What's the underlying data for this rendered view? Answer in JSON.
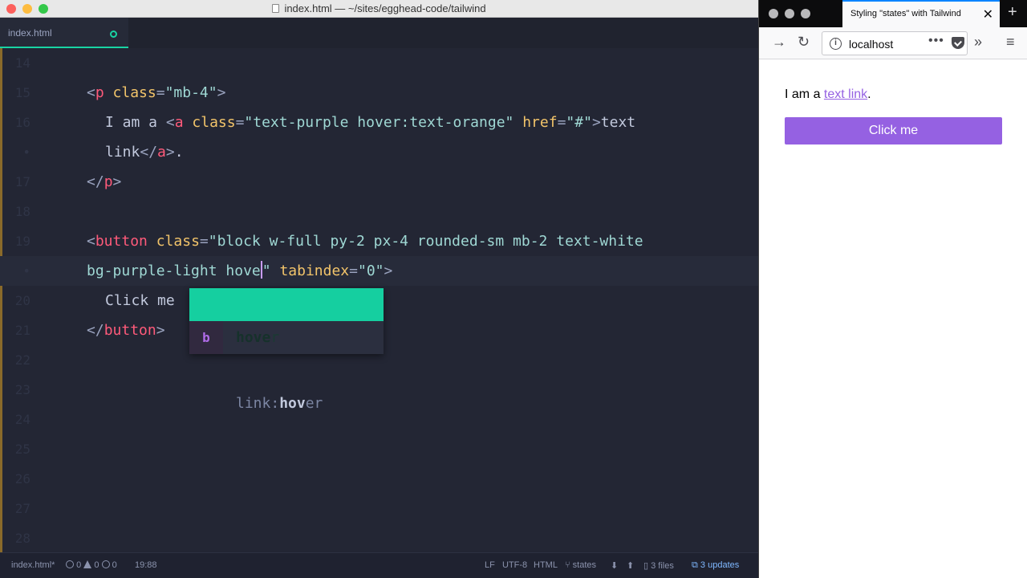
{
  "editor": {
    "window_title": "index.html — ~/sites/egghead-code/tailwind",
    "tab_label": "index.html",
    "lines": [
      {
        "num": "14",
        "parts": []
      },
      {
        "num": "15",
        "parts": [
          [
            "pun",
            "<"
          ],
          [
            "tag",
            "p"
          ],
          [
            "plain",
            " "
          ],
          [
            "attr",
            "class"
          ],
          [
            "pun",
            "="
          ],
          [
            "str",
            "\"mb-4\""
          ],
          [
            "pun",
            ">"
          ]
        ]
      },
      {
        "num": "16",
        "indent": 2,
        "parts": [
          [
            "plain",
            "I am a "
          ],
          [
            "pun",
            "<"
          ],
          [
            "tag",
            "a"
          ],
          [
            "plain",
            " "
          ],
          [
            "attr",
            "class"
          ],
          [
            "pun",
            "="
          ],
          [
            "str",
            "\"text-purple hover:text-orange\""
          ],
          [
            "plain",
            " "
          ],
          [
            "attr",
            "href"
          ],
          [
            "pun",
            "="
          ],
          [
            "str",
            "\"#\""
          ],
          [
            "pun",
            ">"
          ],
          [
            "plain",
            "text"
          ]
        ]
      },
      {
        "num": "•",
        "indent": 2,
        "parts": [
          [
            "plain",
            "link"
          ],
          [
            "pun",
            "</"
          ],
          [
            "tag",
            "a"
          ],
          [
            "pun",
            ">"
          ],
          [
            "plain",
            "."
          ]
        ]
      },
      {
        "num": "17",
        "parts": [
          [
            "pun",
            "</"
          ],
          [
            "tag",
            "p"
          ],
          [
            "pun",
            ">"
          ]
        ]
      },
      {
        "num": "18",
        "parts": []
      },
      {
        "num": "19",
        "parts": [
          [
            "pun",
            "<"
          ],
          [
            "tag",
            "button"
          ],
          [
            "plain",
            " "
          ],
          [
            "attr",
            "class"
          ],
          [
            "pun",
            "="
          ],
          [
            "str",
            "\"block w-full py-2 px-4 rounded-sm mb-2 text-white"
          ]
        ]
      },
      {
        "num": "•",
        "active": true,
        "parts": [
          [
            "str",
            "bg-purple-light hove"
          ],
          [
            "cursor",
            ""
          ],
          [
            "str",
            "\""
          ],
          [
            "plain",
            " "
          ],
          [
            "attr",
            "tabindex"
          ],
          [
            "pun",
            "="
          ],
          [
            "str",
            "\"0\""
          ],
          [
            "pun",
            ">"
          ]
        ]
      },
      {
        "num": "20",
        "indent": 2,
        "parts": [
          [
            "plain",
            "Click me"
          ]
        ]
      },
      {
        "num": "21",
        "parts": [
          [
            "pun",
            "</"
          ],
          [
            "tag",
            "button"
          ],
          [
            "pun",
            ">"
          ]
        ]
      },
      {
        "num": "22",
        "parts": []
      },
      {
        "num": "23",
        "parts": []
      },
      {
        "num": "24",
        "parts": []
      },
      {
        "num": "25",
        "parts": []
      },
      {
        "num": "26",
        "parts": []
      },
      {
        "num": "27",
        "parts": []
      },
      {
        "num": "28",
        "parts": []
      }
    ],
    "autocomplete": {
      "selected": {
        "match": "hove",
        "rest": "r"
      },
      "second": {
        "type_badge": "b",
        "prefix": "link:",
        "match": "hov",
        "rest": "er"
      }
    },
    "status": {
      "file": "index.html*",
      "errors": "0",
      "warnings": "0",
      "infos": "0",
      "cursor_pos": "19:88",
      "line_ending": "LF",
      "encoding": "UTF-8",
      "grammar": "HTML",
      "branch": "states",
      "files": "3 files",
      "updates": "3 updates"
    }
  },
  "browser": {
    "tab_title": "Styling \"states\" with Tailwind",
    "url": "localhost",
    "para_before": "I am a ",
    "link_text": "text link",
    "para_after": ".",
    "button_label": "Click me"
  }
}
